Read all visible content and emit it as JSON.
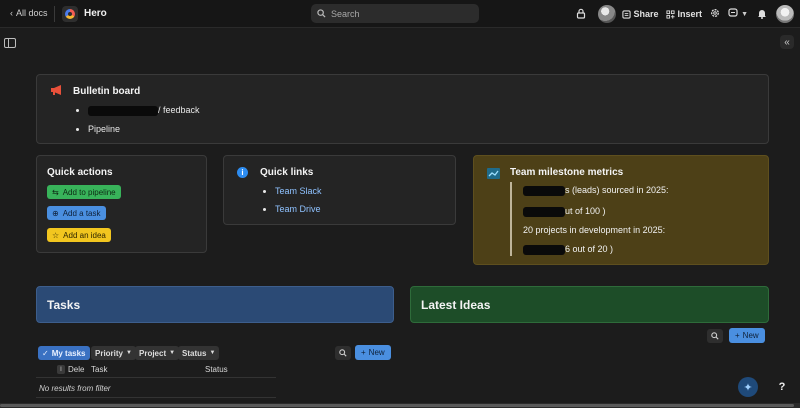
{
  "topbar": {
    "back_label": "All docs",
    "doc_title": "Hero",
    "search_placeholder": "Search",
    "share_label": "Share",
    "insert_label": "Insert"
  },
  "bulletin": {
    "title": "Bulletin board",
    "items": [
      "/ feedback",
      "Pipeline"
    ]
  },
  "quick_actions": {
    "title": "Quick actions",
    "buttons": [
      "Add to pipeline",
      "Add a task",
      "Add an idea"
    ]
  },
  "quick_links": {
    "title": "Quick links",
    "links": [
      "Team Slack",
      "Team Drive"
    ]
  },
  "metrics": {
    "title": "Team milestone metrics",
    "lines": [
      "s (leads) sourced in 2025:",
      "ut of 100  )",
      "20 projects in development in 2025:",
      "6 out of 20  )"
    ]
  },
  "tasks": {
    "title": "Tasks",
    "filters": [
      "My tasks",
      "Priority",
      "Project",
      "Status"
    ],
    "new_label": "New",
    "columns": [
      "Dele",
      "Task",
      "Status"
    ],
    "empty_text": "No results from filter"
  },
  "ideas": {
    "title": "Latest Ideas",
    "new_label": "New"
  },
  "colors": {
    "tasks_header": "#2b4a75",
    "ideas_header": "#1d4d28",
    "metrics_bg": "#4d4017",
    "accent_blue": "#4a8fe0"
  }
}
